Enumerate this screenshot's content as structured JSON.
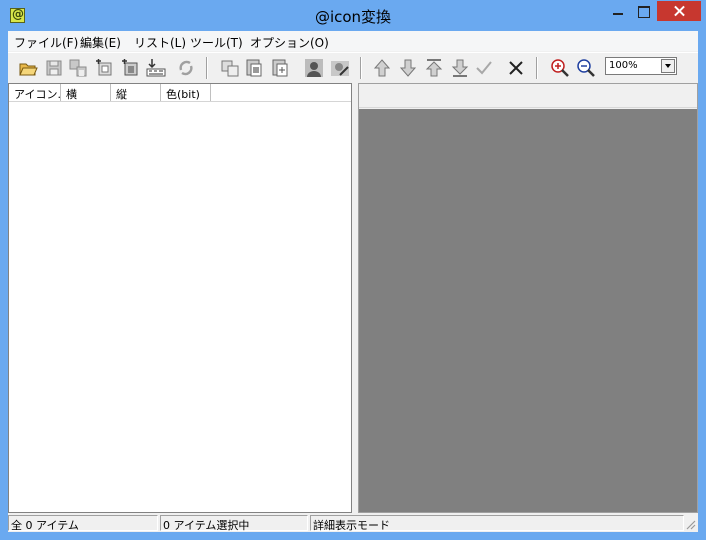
{
  "window": {
    "title": "@icon変換",
    "app_icon_glyph": "@"
  },
  "menu": [
    {
      "label": "ファイル(F)"
    },
    {
      "label": "編集(E)"
    },
    {
      "label": "リスト(L)"
    },
    {
      "label": "ツール(T)"
    },
    {
      "label": "オプション(O)"
    }
  ],
  "toolbar": {
    "icons": [
      "open-folder-icon",
      "save-icon",
      "save-multiple-icon",
      "add-icon",
      "import-icon",
      "export-icon",
      "refresh-icon",
      "copy-icon",
      "paste-icon",
      "duplicate-icon",
      "user-icon",
      "user-edit-icon",
      "move-up-icon",
      "move-down-icon",
      "move-top-icon",
      "move-bottom-icon",
      "check-icon",
      "delete-icon",
      "zoom-in-icon",
      "zoom-out-icon"
    ],
    "zoom_value": "100%"
  },
  "list": {
    "columns": [
      "アイコン...",
      "横",
      "縦",
      "色(bit)"
    ],
    "rows": []
  },
  "statusbar": {
    "total": "全 0 アイテム",
    "selected": "0 アイテム選択中",
    "mode": "詳細表示モード"
  },
  "colors": {
    "titlebar": "#6aa9f0",
    "preview_bg": "#808080",
    "close_button": "#c7372f"
  }
}
